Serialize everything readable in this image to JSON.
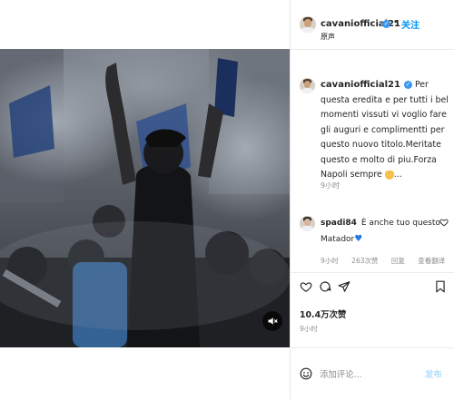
{
  "post": {
    "username": "cavaniofficial21",
    "verified": true,
    "follow_label": "关注",
    "separator": "•",
    "subtitle": "原声",
    "caption_text": "Per questa eredita e per tutti i bel momenti vissuti vi voglio fare gli auguri e complimentti per questo nuovo titolo.Meritate questo e molto di piu.Forza Napoli sempre",
    "caption_more": "...",
    "caption_time": "9小时",
    "likes": "10.4万次赞",
    "time": "9小时"
  },
  "comment": {
    "username": "spadi84",
    "text": "È anche tuo questo Matador",
    "time": "9小时",
    "likes": "263次赞",
    "reply": "回复",
    "translate": "查看翻译"
  },
  "composer": {
    "placeholder": "添加评论...",
    "post_label": "发布"
  },
  "icons": {
    "verified": "verified-badge-icon",
    "heart": "heart-icon",
    "comment": "comment-icon",
    "share": "share-icon",
    "save": "bookmark-icon",
    "mute": "speaker-muted-icon",
    "emoji": "emoji-icon"
  },
  "colors": {
    "link": "#0095f6",
    "verified": "#3897f0",
    "muted_text": "#8e8e8e",
    "post_disabled": "#b2dffc"
  }
}
